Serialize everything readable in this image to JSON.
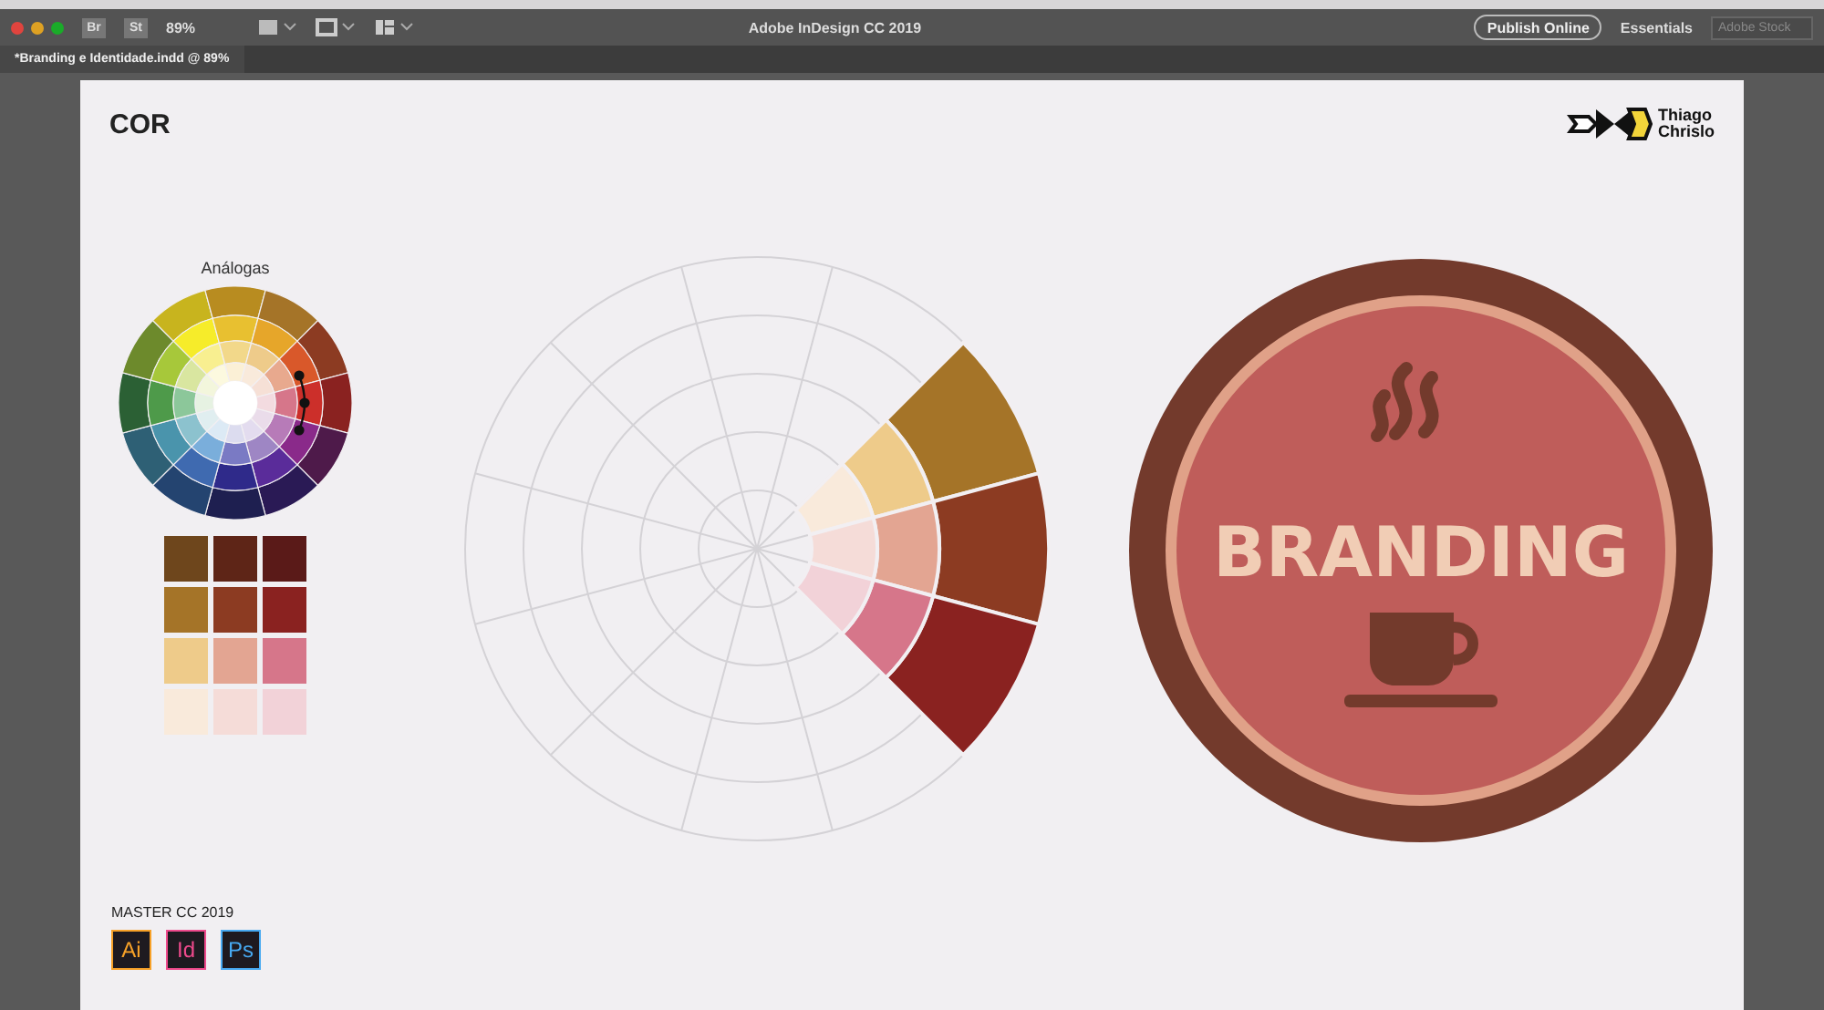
{
  "app_bar": {
    "bridge_label": "Br",
    "stock_label": "St",
    "zoom": "89%",
    "title": "Adobe InDesign CC 2019",
    "publish_button": "Publish Online",
    "workspace": "Essentials",
    "search": {
      "placeholder": "Adobe Stock"
    }
  },
  "document_tab": {
    "label": "*Branding e Identidade.indd @ 89%",
    "selected": true
  },
  "page": {
    "heading": "COR",
    "logo": {
      "name_lines": [
        "Thiago",
        "Chrislo"
      ]
    },
    "scheme_label": "Análogas",
    "swatches": [
      {
        "color": "#6e461c"
      },
      {
        "color": "#5e2517"
      },
      {
        "color": "#5a1a18"
      },
      {
        "color": "#a57428"
      },
      {
        "color": "#8c3b22"
      },
      {
        "color": "#8a2220"
      },
      {
        "color": "#eecb8a"
      },
      {
        "color": "#e3a592"
      },
      {
        "color": "#d6768a"
      },
      {
        "color": "#f9eadb"
      },
      {
        "color": "#f5dcd8"
      },
      {
        "color": "#f2d2d8"
      }
    ],
    "badge": {
      "text": "BRANDING"
    },
    "footer": {
      "label": "MASTER CC 2019",
      "apps": [
        {
          "label": "Ai",
          "color": "#f7a128"
        },
        {
          "label": "Id",
          "color": "#ef4a8c"
        },
        {
          "label": "Ps",
          "color": "#47a9f1"
        }
      ]
    }
  }
}
